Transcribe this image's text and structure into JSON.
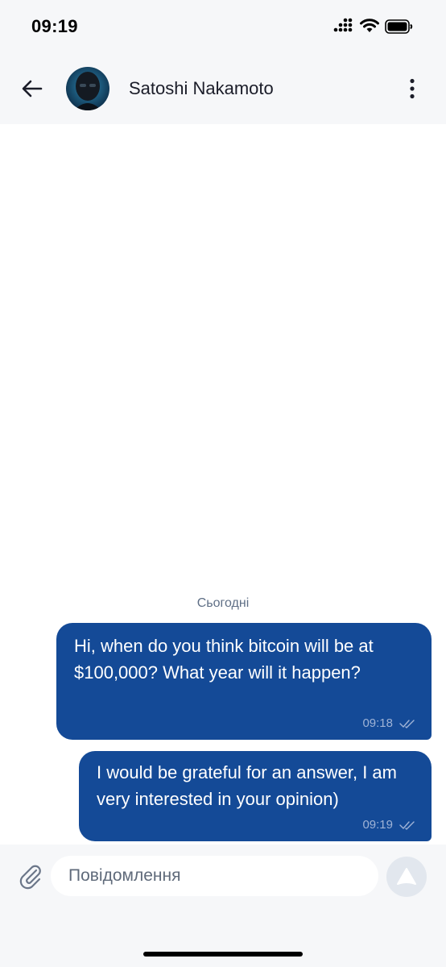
{
  "status_bar": {
    "time": "09:19",
    "icons": [
      "cellular-signal-icon",
      "wifi-icon",
      "battery-icon"
    ]
  },
  "header": {
    "back_icon": "arrow-left-icon",
    "contact_name": "Satoshi Nakamoto",
    "more_icon": "more-vertical-icon"
  },
  "chat": {
    "date_separator": "Сьогодні",
    "messages": [
      {
        "text": "Hi, when do you think bitcoin will be at $100,000? What year will it happen?",
        "time": "09:18",
        "status": "read"
      },
      {
        "text": "I would be grateful for an answer, I am very interested in your opinion)",
        "time": "09:19",
        "status": "read"
      }
    ]
  },
  "composer": {
    "attach_icon": "paperclip-icon",
    "placeholder": "Повідомлення",
    "value": "",
    "send_icon": "send-icon"
  },
  "colors": {
    "bubble": "#144a97",
    "header_bg": "#f6f7f9",
    "date_text": "#5f6f86",
    "send_button_bg": "#e2e7ee"
  }
}
